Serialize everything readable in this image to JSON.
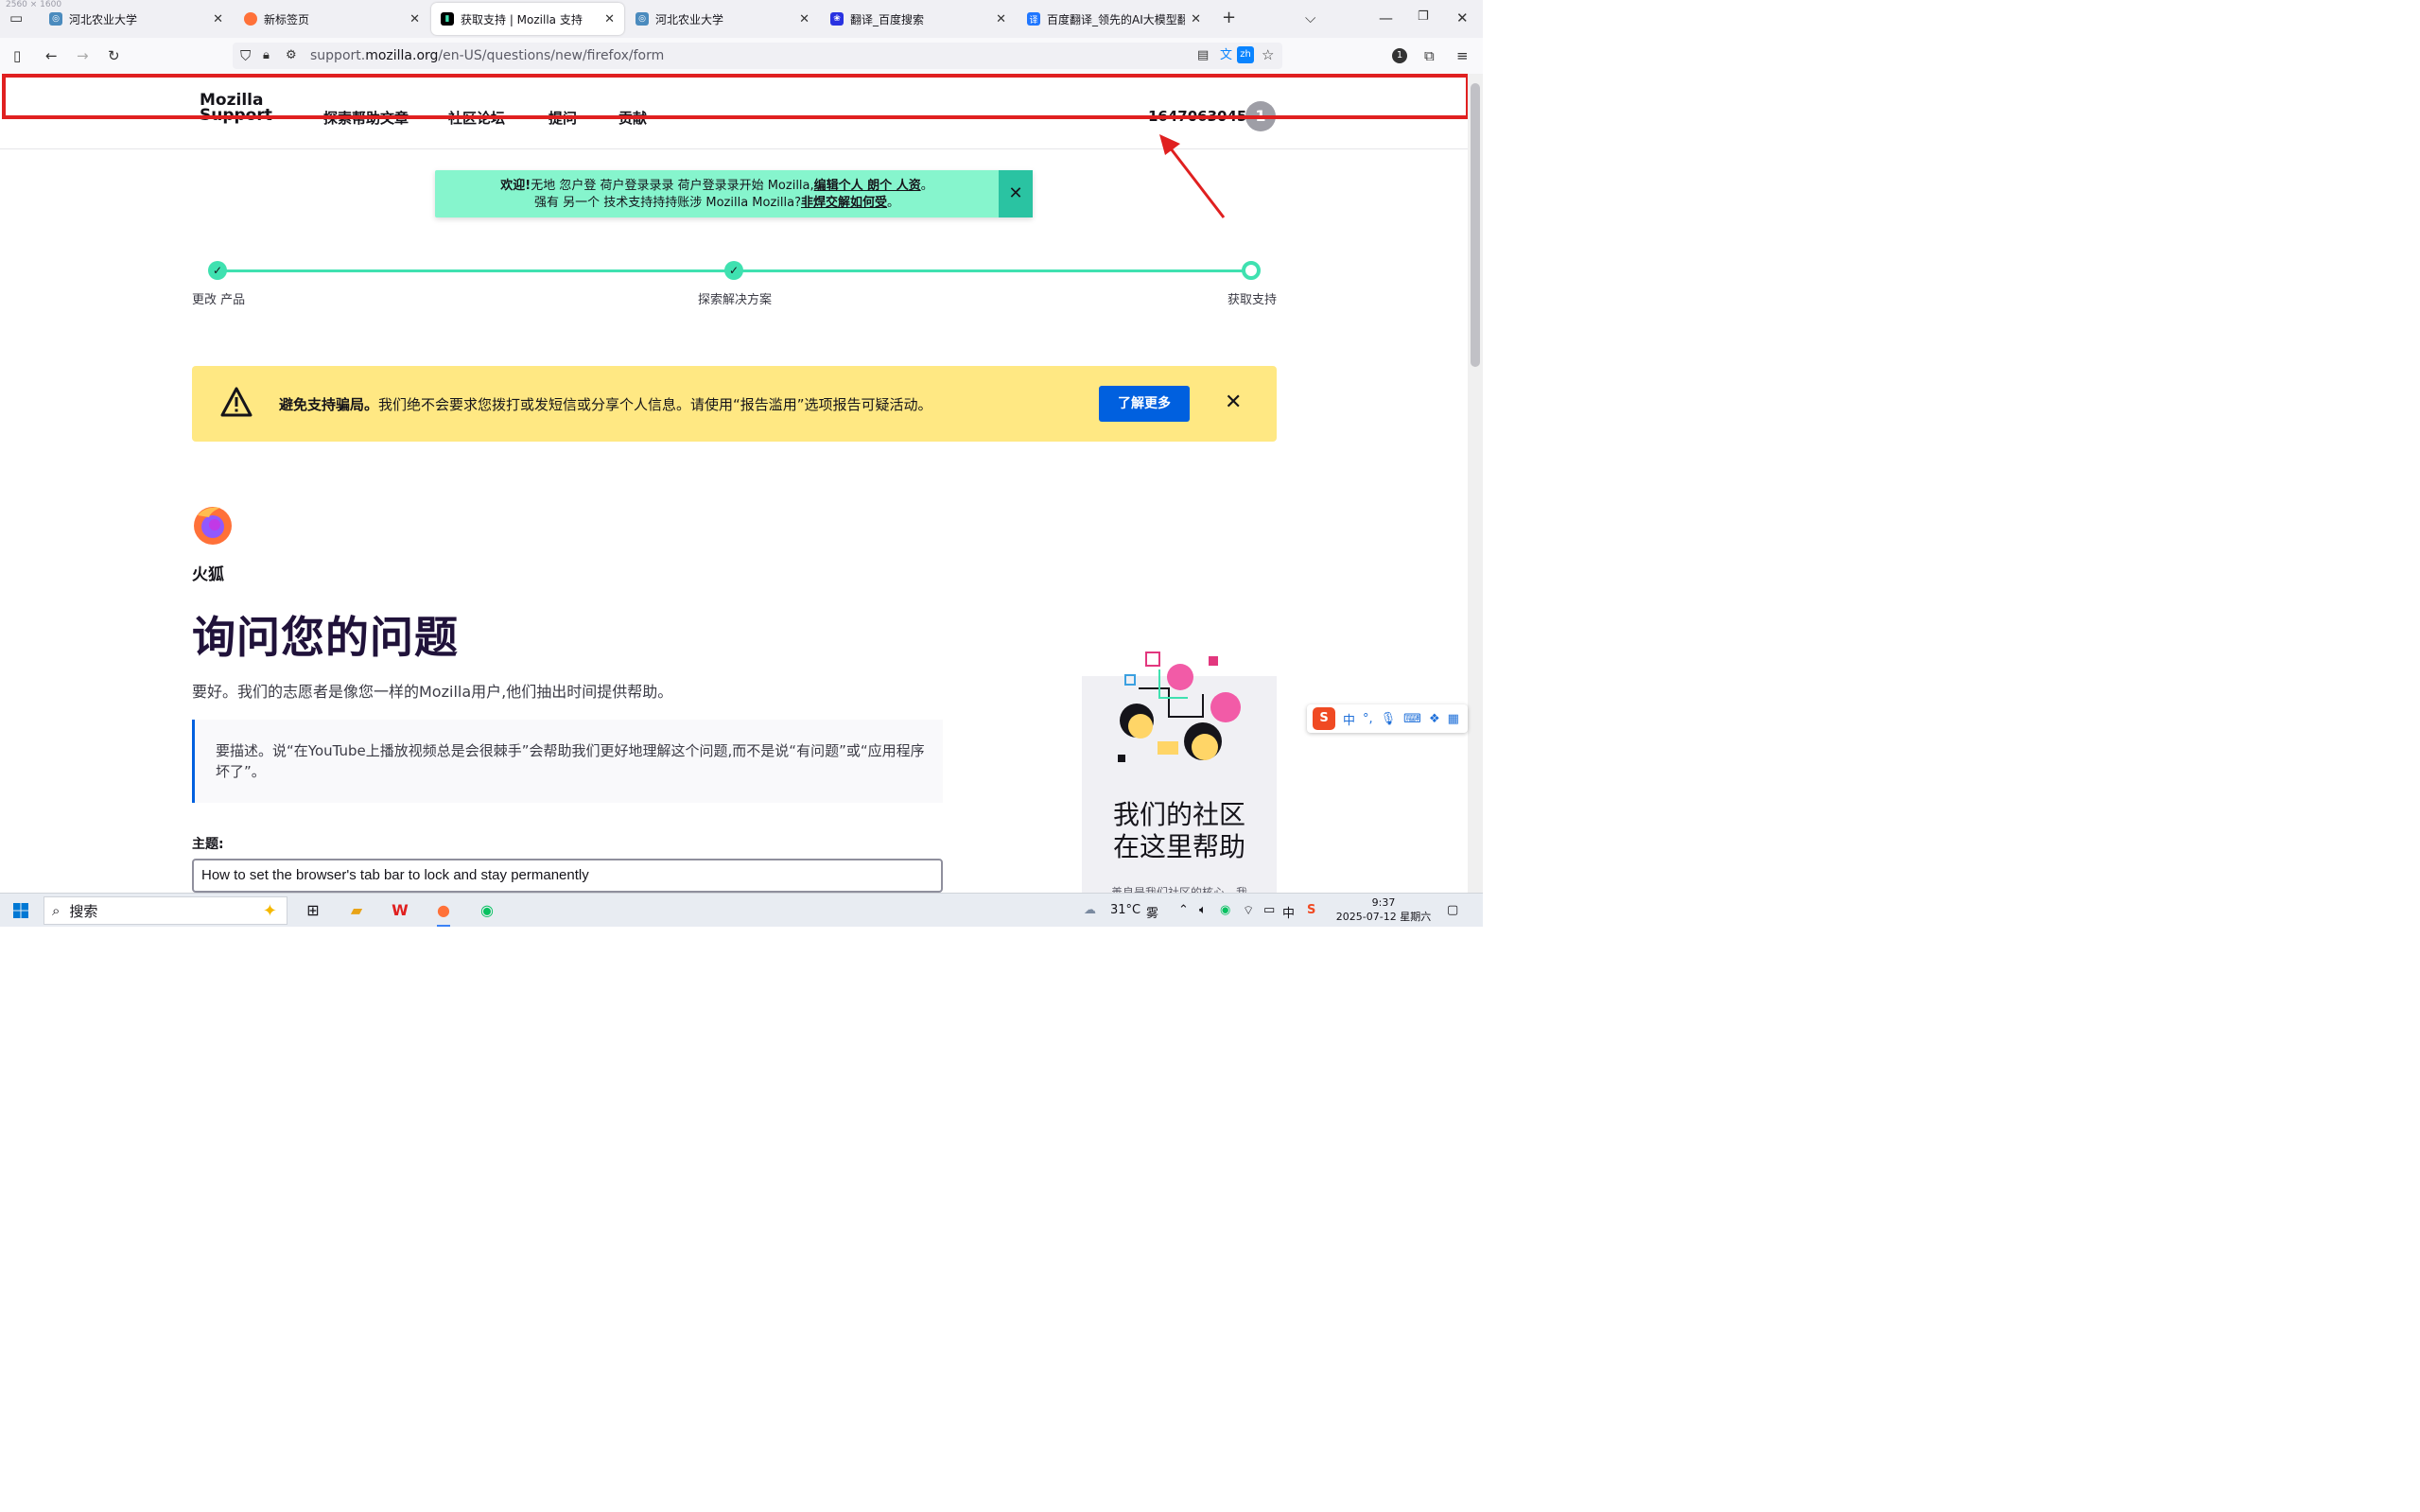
{
  "overlay_size": "2560 × 1600",
  "tabs": [
    {
      "title": "河北农业大学",
      "favicon": "globe-icon"
    },
    {
      "title": "新标签页",
      "favicon": "firefox-icon"
    },
    {
      "title": "获取支持 | Mozilla 支持",
      "favicon": "mozilla-support-icon",
      "active": true
    },
    {
      "title": "河北农业大学",
      "favicon": "globe-icon"
    },
    {
      "title": "翻译_百度搜索",
      "favicon": "baidu-icon"
    },
    {
      "title": "百度翻译_领先的AI大模型翻译_",
      "favicon": "baidu-translate-icon"
    }
  ],
  "url": {
    "domain_prefix": "support.",
    "domain": "mozilla.org",
    "path": "/en-US/questions/new/firefox/form"
  },
  "toolbar": {
    "translate_badge": "zh",
    "extension_badge": "1"
  },
  "site": {
    "logo_line1": "Mozilla",
    "logo_line2": "Support",
    "nav": [
      "探索帮助文章",
      "社区论坛",
      "提问",
      "贡献"
    ],
    "username": "1647063045",
    "avatar_letter": "1"
  },
  "welcome": {
    "line1_bold": "欢迎!",
    "line1_text": "无地 忽户登 荷户登录录录 荷户登录录开始 Mozilla,",
    "line1_link": "编辑个人 朗个 人资",
    "line1_end": "。",
    "line2_text": "强有 另一个 技术支持持持账涉 Mozilla Mozilla?",
    "line2_link": "非焊交解如何受",
    "line2_end": "。"
  },
  "steps": [
    "更改 产品",
    "探索解决方案",
    "获取支持"
  ],
  "warning": {
    "bold": "避免支持骗局。",
    "text": "我们绝不会要求您拨打或发短信或分享个人信息。请使用“报告滥用”选项报告可疑活动。",
    "button": "了解更多"
  },
  "product": "火狐",
  "title": "询问您的问题",
  "intro": "要好。我们的志愿者是像您一样的Mozilla用户,他们抽出时间提供帮助。",
  "tip": "要描述。说“在YouTube上播放视频总是会很棘手”会帮助我们更好地理解这个问题,而不是说“有问题”或“应用程序坏了”。",
  "subject_label": "主题:",
  "subject_value": "How to set the browser's tab bar to lock and stay permanently",
  "side": {
    "title_line1": "我们的社区",
    "title_line2": "在这里帮助",
    "subtitle": "善良是我们社区的核心。我"
  },
  "ime": {
    "logo": "S",
    "mode": "中",
    "punct": "°,"
  },
  "taskbar": {
    "search": "搜索",
    "weather": "31°C",
    "weather_desc": "雾",
    "ime_tray": "中",
    "time": "9:37",
    "date": "2025-07-12 星期六"
  },
  "colors": {
    "accent": "#0060df",
    "mint": "#86f5cd",
    "step": "#3fe1b0",
    "warning": "#ffe883",
    "annotation": "#e02020"
  }
}
